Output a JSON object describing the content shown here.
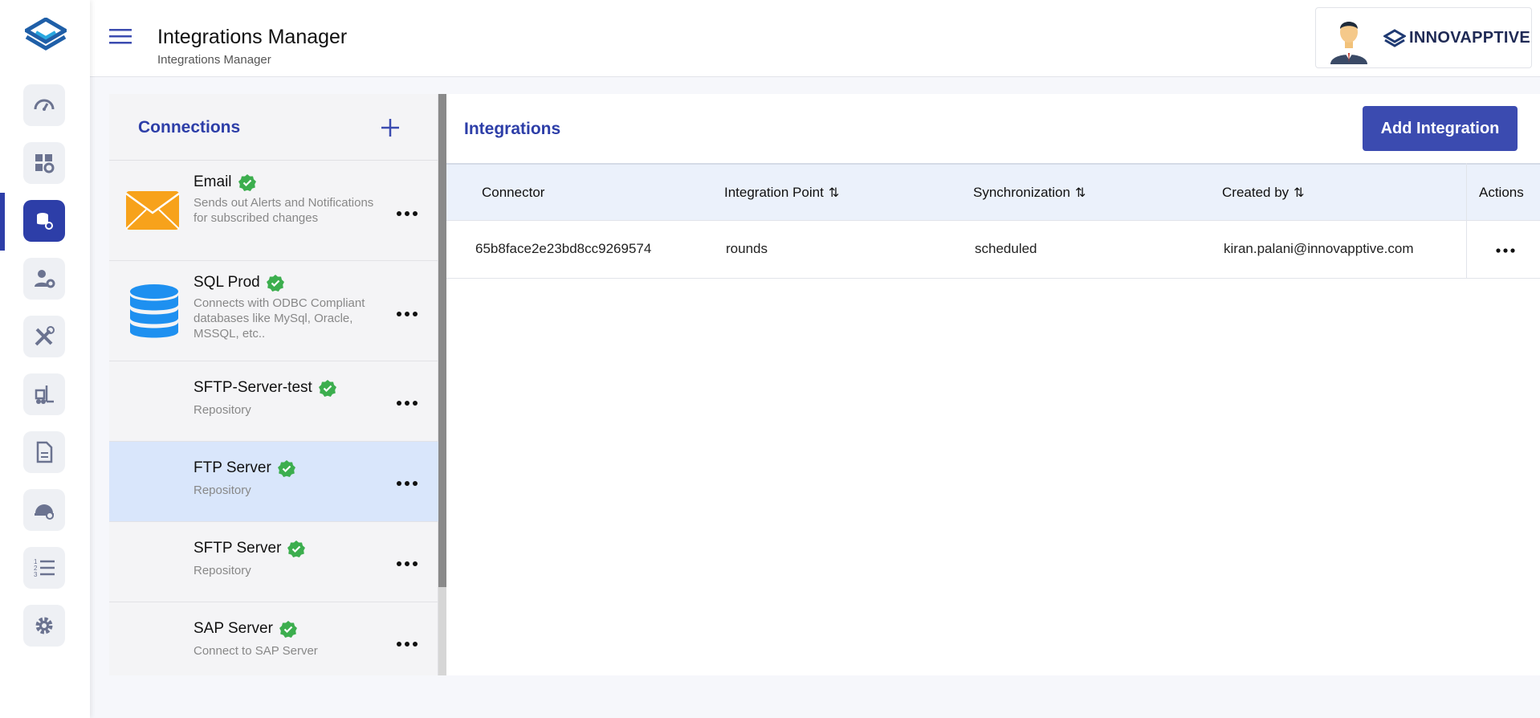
{
  "header": {
    "title": "Integrations Manager",
    "subtitle": "Integrations Manager",
    "brand_name": "INNOVAPPTIVE"
  },
  "sidebar": {
    "items": [
      {
        "icon": "gauge-icon",
        "active": false
      },
      {
        "icon": "widgets-settings-icon",
        "active": false
      },
      {
        "icon": "database-settings-icon",
        "active": true
      },
      {
        "icon": "user-settings-icon",
        "active": false
      },
      {
        "icon": "tools-icon",
        "active": false
      },
      {
        "icon": "forklift-icon",
        "active": false
      },
      {
        "icon": "document-icon",
        "active": false
      },
      {
        "icon": "hard-hat-icon",
        "active": false
      },
      {
        "icon": "numbered-list-icon",
        "active": false
      },
      {
        "icon": "gear-icon",
        "active": false
      }
    ]
  },
  "connections": {
    "title": "Connections",
    "items": [
      {
        "name": "Email",
        "description": "Sends out Alerts and Notifications for subscribed changes",
        "icon": "envelope-icon",
        "selected": false,
        "verified": true
      },
      {
        "name": "SQL Prod",
        "description": "Connects with ODBC Compliant databases like MySql, Oracle, MSSQL, etc..",
        "icon": "database-icon",
        "selected": false,
        "verified": true
      },
      {
        "name": "SFTP-Server-test",
        "description": "Repository",
        "icon": "",
        "selected": false,
        "verified": true
      },
      {
        "name": "FTP Server",
        "description": "Repository",
        "icon": "",
        "selected": true,
        "verified": true
      },
      {
        "name": "SFTP Server",
        "description": "Repository",
        "icon": "",
        "selected": false,
        "verified": true
      },
      {
        "name": "SAP Server",
        "description": "Connect to SAP Server",
        "icon": "",
        "selected": false,
        "verified": true
      }
    ]
  },
  "integrations": {
    "title": "Integrations",
    "add_button_label": "Add Integration",
    "columns": [
      "Connector",
      "Integration Point",
      "Synchronization",
      "Created by",
      "Actions"
    ],
    "rows": [
      {
        "connector": "65b8face2e23bd8cc9269574",
        "integration_point": "rounds",
        "synchronization": "scheduled",
        "created_by": "kiran.palani@innovapptive.com"
      }
    ]
  },
  "colors": {
    "accent": "#2d3ea8",
    "button": "#3b4bb0",
    "selected_row": "#d9e6fb",
    "verified_green": "#3cae4e",
    "email_orange": "#f7a21b",
    "database_blue": "#1e90f0"
  }
}
